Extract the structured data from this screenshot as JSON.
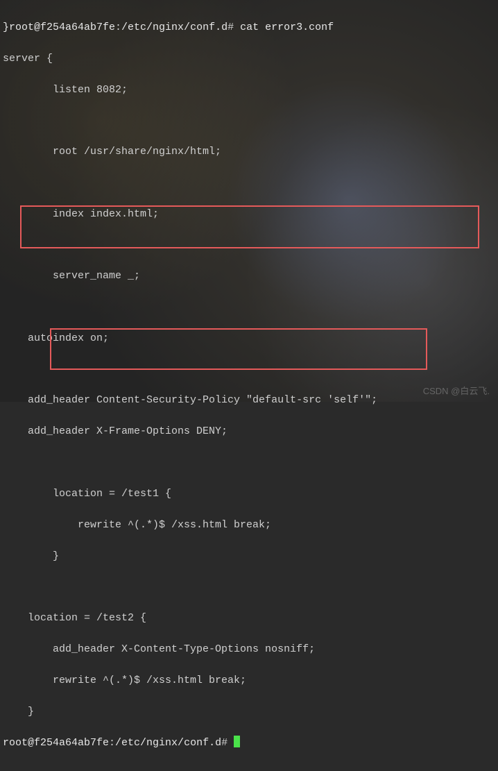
{
  "prompt1": {
    "user_host": "}root@f254a64ab7fe",
    "sep1": ":",
    "path": "/etc/nginx/conf.d",
    "sep2": "# ",
    "command": "cat error3.conf"
  },
  "config": {
    "l1": "server {",
    "l2": "        listen 8082;",
    "l3": "",
    "l4": "        root /usr/share/nginx/html;",
    "l5": "",
    "l6": "        index index.html;",
    "l7": "",
    "l8": "        server_name _;",
    "l9": "",
    "l10": "    autoindex on;",
    "l11": "",
    "l12": "    add_header Content-Security-Policy \"default-src 'self'\";",
    "l13": "    add_header X-Frame-Options DENY;",
    "l14": "",
    "l15": "        location = /test1 {",
    "l16": "            rewrite ^(.*)$ /xss.html break;",
    "l17": "        }",
    "l18": "",
    "l19": "    location = /test2 {",
    "l20": "        add_header X-Content-Type-Options nosniff;",
    "l21": "        rewrite ^(.*)$ /xss.html break;",
    "l22": "    }"
  },
  "prompt2": {
    "user_host": "root@f254a64ab7fe",
    "sep1": ":",
    "path": "/etc/nginx/conf.d",
    "sep2": "# "
  },
  "watermark": "CSDN @白云飞."
}
